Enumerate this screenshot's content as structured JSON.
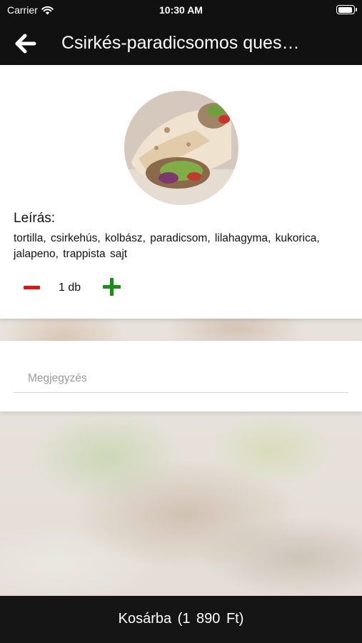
{
  "status_bar": {
    "carrier": "Carrier",
    "time": "10:30 AM",
    "icons": [
      "wifi-icon",
      "battery-icon"
    ]
  },
  "nav": {
    "back_icon": "arrow-left-icon",
    "title": "Csirkés-paradicsomos quesadilla"
  },
  "product": {
    "image": "chicken-tortilla-wrap",
    "description_label": "Leírás:",
    "description": "tortilla, csirkehús, kolbász, paradicsom, lilahagyma, kukorica, jalapeno, trappista sajt",
    "quantity": {
      "value": "1 db",
      "minus_icon": "minus-icon",
      "plus_icon": "plus-icon",
      "minus_color": "#e8110f",
      "plus_color": "#1c8a1c"
    }
  },
  "note": {
    "placeholder": "Megjegyzés",
    "value": ""
  },
  "cart_button": {
    "label": "Kosárba (1 890 Ft)"
  }
}
